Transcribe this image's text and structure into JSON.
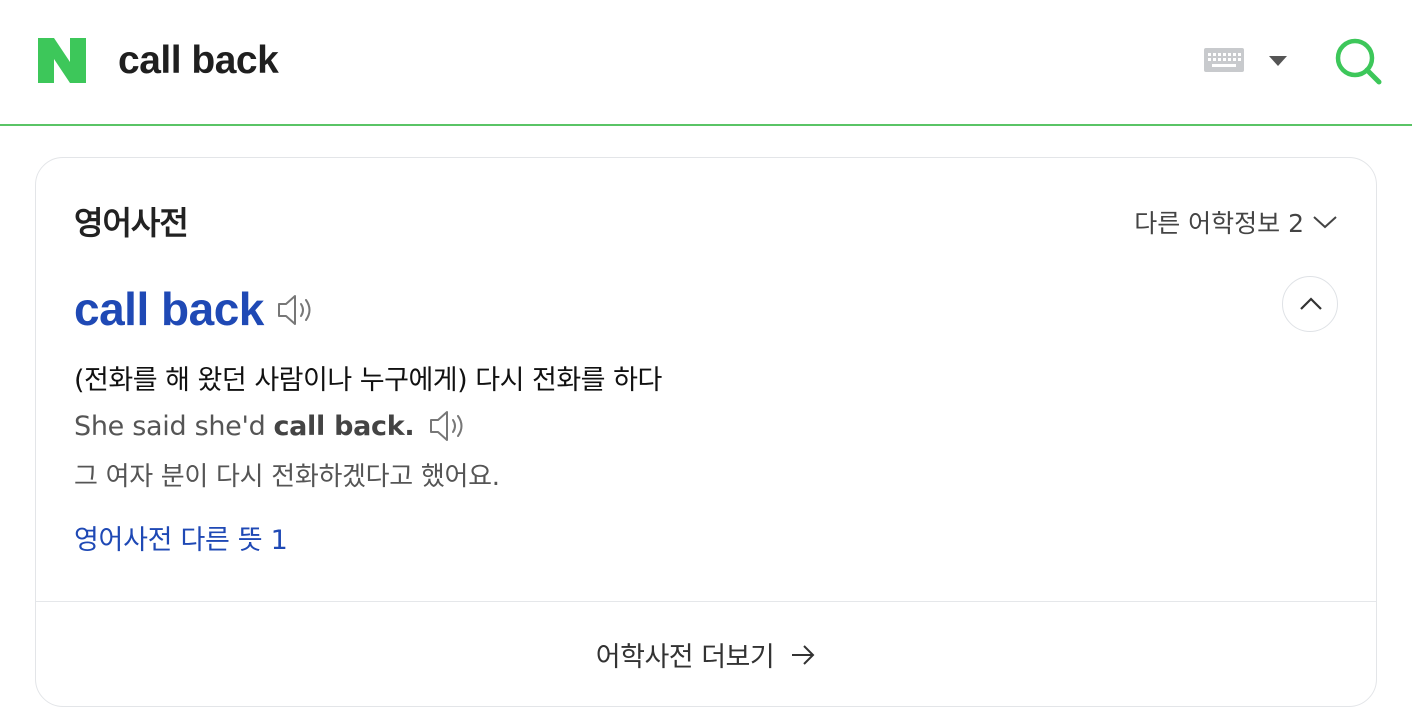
{
  "search": {
    "query": "call back",
    "logo_letter": "N",
    "brand_color": "#03c75a"
  },
  "card": {
    "title": "영어사전",
    "other_info": "다른 어학정보 2",
    "entry": {
      "word": "call back",
      "meaning": "(전화를 해 왔던 사람이나 누구에게) 다시 전화를 하다",
      "example_en_prefix": "She said she'd",
      "example_en_bold": "call back.",
      "example_ko": "그 여자 분이 다시 전화하겠다고 했어요.",
      "other_meaning_link": "영어사전 다른 뜻 1"
    },
    "more_link": "어학사전 더보기"
  },
  "colors": {
    "accent_green": "#5ac466",
    "link_blue": "#1f49b5"
  },
  "icons": [
    "naver-logo-icon",
    "keyboard-icon",
    "dropdown-caret-icon",
    "search-icon",
    "chevron-down-icon",
    "speaker-icon",
    "chevron-up-icon",
    "arrow-right-icon"
  ]
}
